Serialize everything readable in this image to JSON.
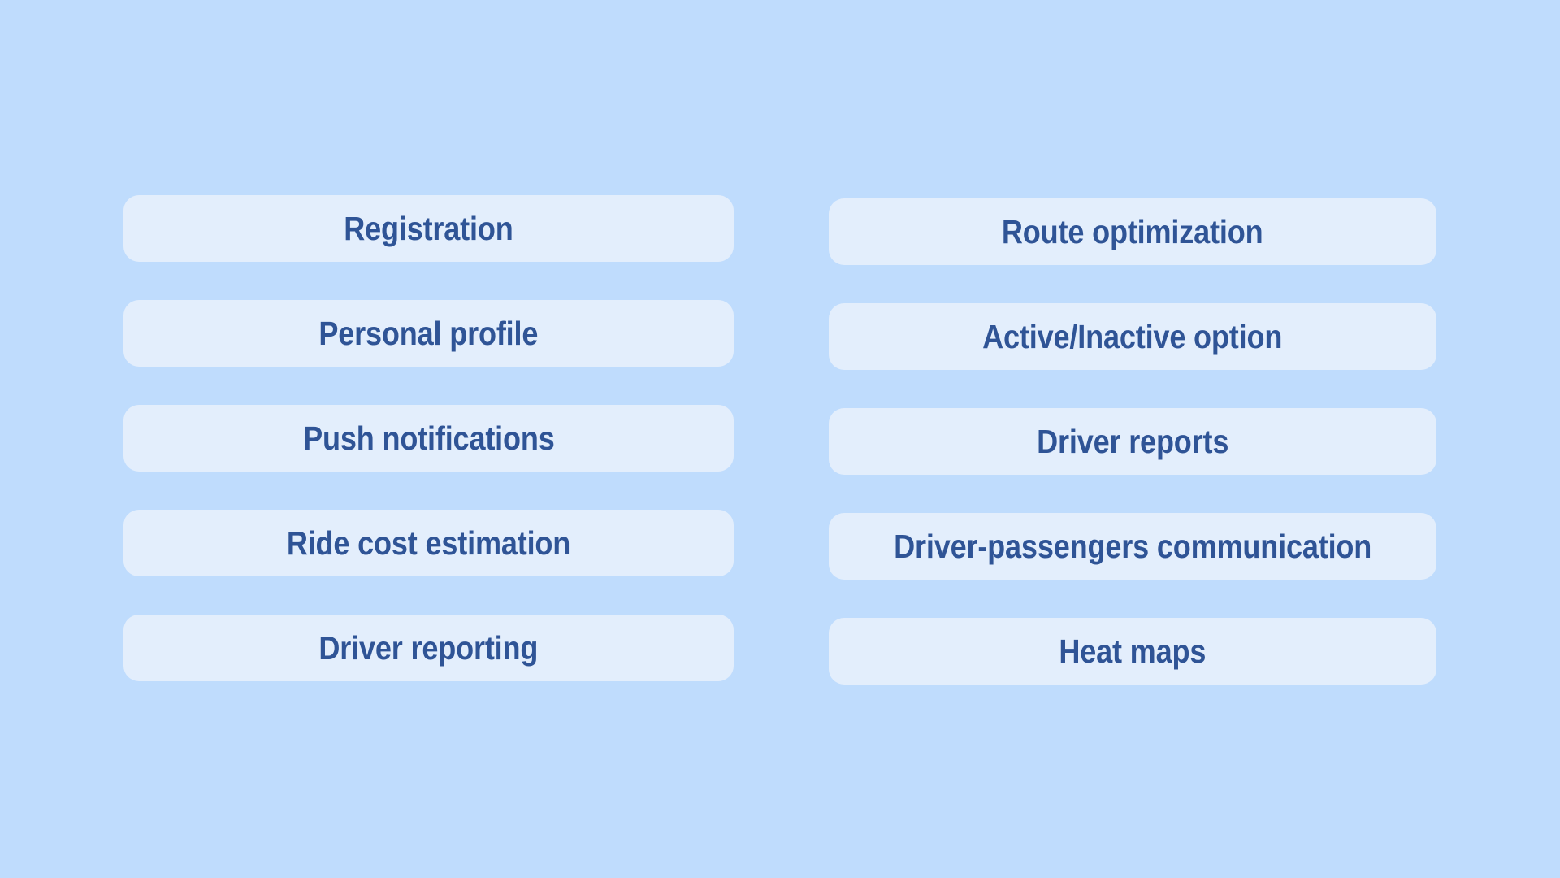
{
  "page": {
    "background_color": "#bfdcfd",
    "pill_color": "#e3eefc",
    "text_color": "#2f5496",
    "layout": "two-column-pill-list"
  },
  "columns": [
    {
      "id": "left",
      "name": "passenger-app-features",
      "items": [
        {
          "label": "Registration"
        },
        {
          "label": "Personal profile"
        },
        {
          "label": "Push notifications"
        },
        {
          "label": "Ride cost estimation"
        },
        {
          "label": "Driver reporting"
        }
      ]
    },
    {
      "id": "right",
      "name": "driver-app-features",
      "items": [
        {
          "label": "Route optimization"
        },
        {
          "label": "Active/Inactive option"
        },
        {
          "label": "Driver reports"
        },
        {
          "label": "Driver-passengers communication"
        },
        {
          "label": "Heat maps"
        }
      ]
    }
  ]
}
